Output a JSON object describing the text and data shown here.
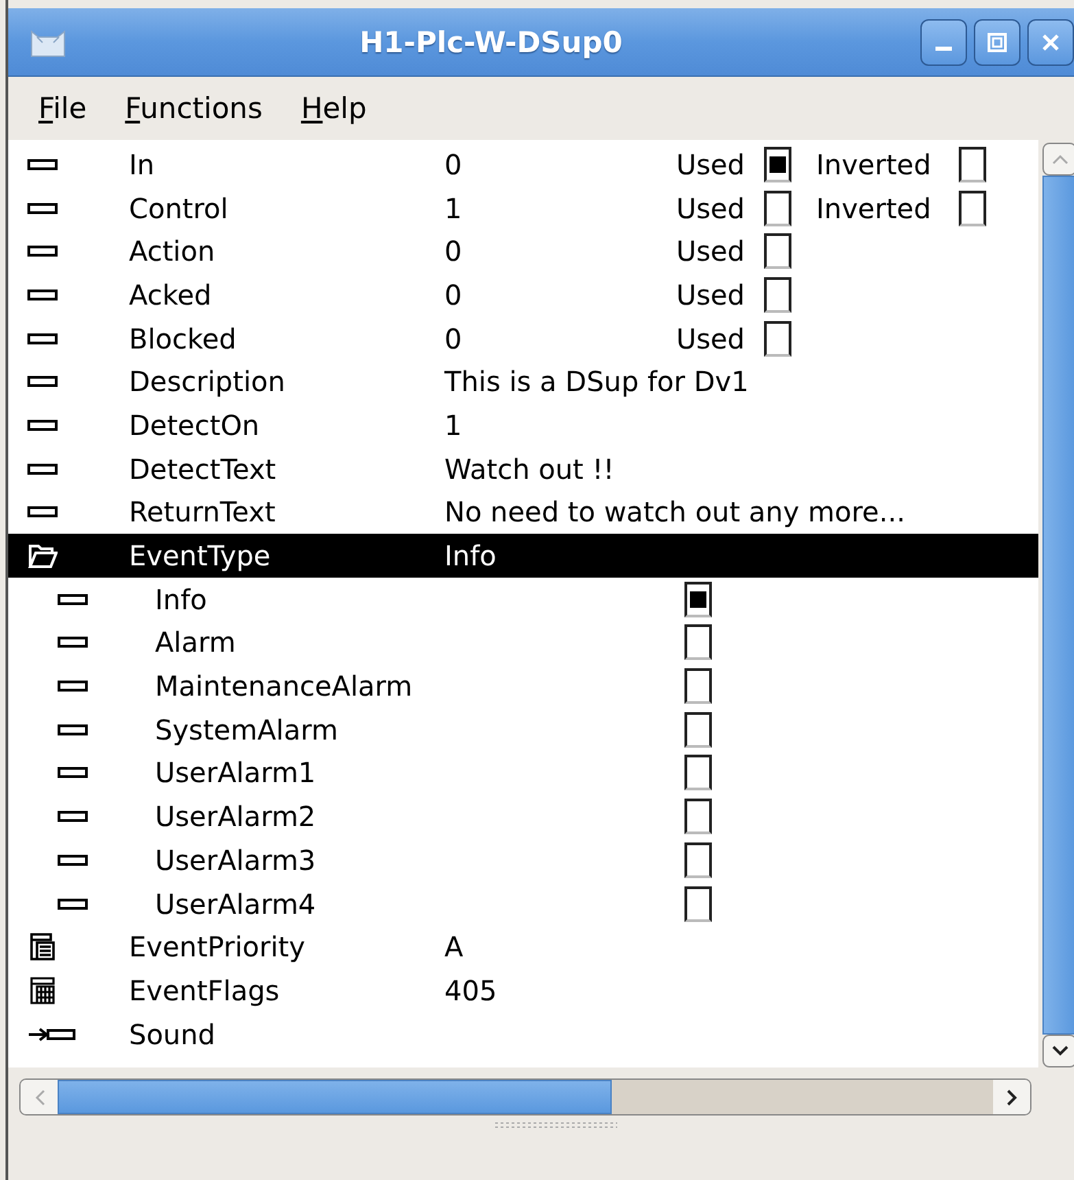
{
  "window": {
    "title": "H1-Plc-W-DSup0"
  },
  "menu": [
    {
      "label": "File"
    },
    {
      "label": "Functions"
    },
    {
      "label": "Help"
    }
  ],
  "rows": [
    {
      "kind": "attribute",
      "name": "In",
      "value": "0",
      "selected": false,
      "checks": [
        {
          "label": "Used",
          "checked": true
        },
        {
          "label": "Inverted",
          "checked": false
        }
      ]
    },
    {
      "kind": "attribute",
      "name": "Control",
      "value": "1",
      "selected": false,
      "checks": [
        {
          "label": "Used",
          "checked": false
        },
        {
          "label": "Inverted",
          "checked": false
        }
      ]
    },
    {
      "kind": "attribute",
      "name": "Action",
      "value": "0",
      "selected": false,
      "checks": [
        {
          "label": "Used",
          "checked": false
        }
      ]
    },
    {
      "kind": "attribute",
      "name": "Acked",
      "value": "0",
      "selected": false,
      "checks": [
        {
          "label": "Used",
          "checked": false
        }
      ]
    },
    {
      "kind": "attribute",
      "name": "Blocked",
      "value": "0",
      "selected": false,
      "checks": [
        {
          "label": "Used",
          "checked": false
        }
      ]
    },
    {
      "kind": "attribute",
      "name": "Description",
      "value": "This is a DSup for Dv1",
      "selected": false
    },
    {
      "kind": "attribute",
      "name": "DetectOn",
      "value": "1",
      "selected": false
    },
    {
      "kind": "attribute",
      "name": "DetectText",
      "value": "Watch out !!",
      "selected": false
    },
    {
      "kind": "attribute",
      "name": "ReturnText",
      "value": "No need to watch out any more...",
      "selected": false
    },
    {
      "kind": "folder",
      "name": "EventType",
      "value": "Info",
      "selected": true,
      "expanded": true,
      "children": [
        {
          "name": "Info",
          "checked": true
        },
        {
          "name": "Alarm",
          "checked": false
        },
        {
          "name": "MaintenanceAlarm",
          "checked": false
        },
        {
          "name": "SystemAlarm",
          "checked": false
        },
        {
          "name": "UserAlarm1",
          "checked": false
        },
        {
          "name": "UserAlarm2",
          "checked": false
        },
        {
          "name": "UserAlarm3",
          "checked": false
        },
        {
          "name": "UserAlarm4",
          "checked": false
        }
      ]
    },
    {
      "kind": "struct",
      "name": "EventPriority",
      "value": "A",
      "selected": false
    },
    {
      "kind": "array",
      "name": "EventFlags",
      "value": "405",
      "selected": false
    },
    {
      "kind": "pointer",
      "name": "Sound",
      "selected": false
    }
  ]
}
